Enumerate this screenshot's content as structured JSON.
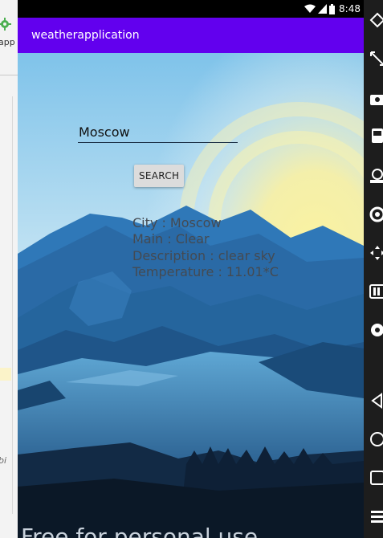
{
  "ide": {
    "sidebar_text": "app",
    "hint_text": "bi"
  },
  "status_bar": {
    "time": "8:48",
    "icons": [
      "wifi-icon",
      "signal-icon",
      "battery-icon"
    ]
  },
  "app": {
    "title": "weatherapplication",
    "toolbar_color": "#6200ee"
  },
  "search": {
    "value": "Moscow"
  },
  "search_button_label": "SEARCH",
  "results": {
    "city": "City : Moscow",
    "main": "Main : Clear",
    "description": "Description : clear sky",
    "temperature": "Temperature : 11.01*C"
  },
  "watermark": "Free for personal use",
  "emulator_toolbar": {
    "tools": [
      "power-icon",
      "resize-icon",
      "camera-icon",
      "phone-icon",
      "gps-icon",
      "location-icon",
      "dpad-icon",
      "battery-tool-icon",
      "record-icon",
      "back-icon",
      "home-icon",
      "overview-icon",
      "menu-icon"
    ]
  }
}
